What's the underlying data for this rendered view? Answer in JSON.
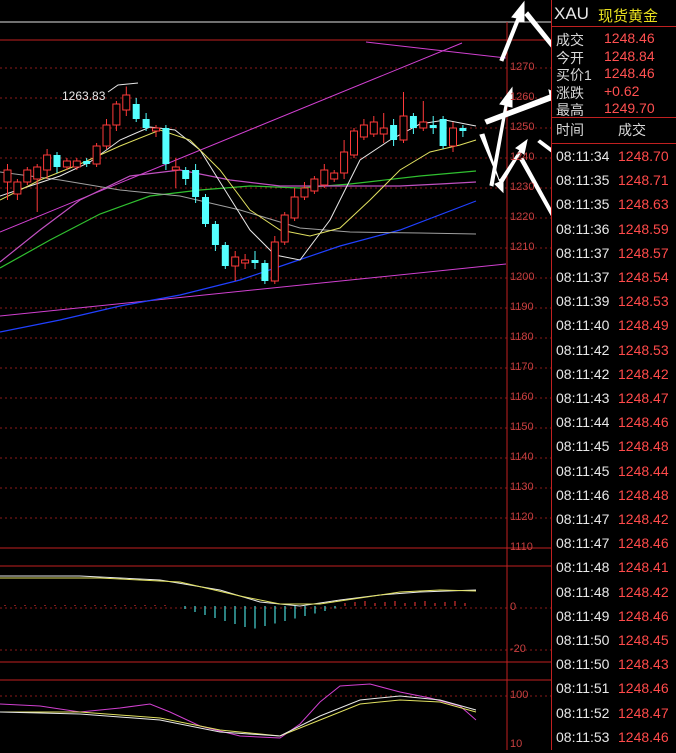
{
  "symbol": {
    "code": "XAU",
    "name": "现货黄金"
  },
  "quote": [
    {
      "label": "成交",
      "value": "1248.46"
    },
    {
      "label": "今开",
      "value": "1248.84"
    },
    {
      "label": "买价1",
      "value": "1248.46"
    },
    {
      "label": "涨跌",
      "value": "+0.62"
    },
    {
      "label": "最高",
      "value": "1249.70"
    }
  ],
  "trades_header": {
    "time": "时间",
    "price": "成交"
  },
  "trades": [
    {
      "time": "08:11:34",
      "price": "1248.70"
    },
    {
      "time": "08:11:35",
      "price": "1248.71"
    },
    {
      "time": "08:11:35",
      "price": "1248.63"
    },
    {
      "time": "08:11:36",
      "price": "1248.59"
    },
    {
      "time": "08:11:37",
      "price": "1248.57"
    },
    {
      "time": "08:11:37",
      "price": "1248.54"
    },
    {
      "time": "08:11:39",
      "price": "1248.53"
    },
    {
      "time": "08:11:40",
      "price": "1248.49"
    },
    {
      "time": "08:11:42",
      "price": "1248.53"
    },
    {
      "time": "08:11:42",
      "price": "1248.42"
    },
    {
      "time": "08:11:43",
      "price": "1248.47"
    },
    {
      "time": "08:11:44",
      "price": "1248.46"
    },
    {
      "time": "08:11:45",
      "price": "1248.48"
    },
    {
      "time": "08:11:45",
      "price": "1248.44"
    },
    {
      "time": "08:11:46",
      "price": "1248.48"
    },
    {
      "time": "08:11:47",
      "price": "1248.42"
    },
    {
      "time": "08:11:47",
      "price": "1248.46"
    },
    {
      "time": "08:11:48",
      "price": "1248.41"
    },
    {
      "time": "08:11:48",
      "price": "1248.42"
    },
    {
      "time": "08:11:49",
      "price": "1248.46"
    },
    {
      "time": "08:11:50",
      "price": "1248.45"
    },
    {
      "time": "08:11:50",
      "price": "1248.43"
    },
    {
      "time": "08:11:51",
      "price": "1248.46"
    },
    {
      "time": "08:11:52",
      "price": "1248.47"
    },
    {
      "time": "08:11:53",
      "price": "1248.46"
    }
  ],
  "price_axis": [
    "1270",
    "1260",
    "1250",
    "1240",
    "1230",
    "1220",
    "1210",
    "1200",
    "1190",
    "1180",
    "1170",
    "1160",
    "1150",
    "1140",
    "1130",
    "1120",
    "1110"
  ],
  "macd_axis": [
    "0",
    "-20"
  ],
  "kdj_axis": [
    "100",
    "10"
  ],
  "high_marker": "1263.83",
  "colors": {
    "up": "#ff3a3a",
    "down": "#54ffff",
    "grid": "#8a1a1a",
    "border": "#c02020",
    "axis_text": "#c84040"
  },
  "candles": [
    {
      "o": 1232,
      "c": 1236,
      "h": 1238,
      "l": 1226
    },
    {
      "o": 1228,
      "c": 1232,
      "h": 1233,
      "l": 1226
    },
    {
      "o": 1232,
      "c": 1236,
      "h": 1237,
      "l": 1231
    },
    {
      "o": 1233,
      "c": 1237,
      "h": 1238,
      "l": 1222
    },
    {
      "o": 1236,
      "c": 1241,
      "h": 1243,
      "l": 1233
    },
    {
      "o": 1241,
      "c": 1237,
      "h": 1242,
      "l": 1235
    },
    {
      "o": 1237,
      "c": 1239,
      "h": 1240,
      "l": 1236
    },
    {
      "o": 1237,
      "c": 1239,
      "h": 1240,
      "l": 1236
    },
    {
      "o": 1239,
      "c": 1238,
      "h": 1240,
      "l": 1237
    },
    {
      "o": 1238,
      "c": 1244,
      "h": 1245,
      "l": 1237
    },
    {
      "o": 1244,
      "c": 1251,
      "h": 1253,
      "l": 1243
    },
    {
      "o": 1251,
      "c": 1258,
      "h": 1259,
      "l": 1249
    },
    {
      "o": 1256,
      "c": 1261,
      "h": 1263.83,
      "l": 1254
    },
    {
      "o": 1258,
      "c": 1253,
      "h": 1260,
      "l": 1252
    },
    {
      "o": 1253,
      "c": 1250,
      "h": 1255,
      "l": 1249
    },
    {
      "o": 1249,
      "c": 1250,
      "h": 1251,
      "l": 1247
    },
    {
      "o": 1250,
      "c": 1238,
      "h": 1251,
      "l": 1236
    },
    {
      "o": 1236,
      "c": 1237,
      "h": 1240,
      "l": 1230
    },
    {
      "o": 1236,
      "c": 1233,
      "h": 1237,
      "l": 1231
    },
    {
      "o": 1236,
      "c": 1227,
      "h": 1238,
      "l": 1225
    },
    {
      "o": 1227,
      "c": 1218,
      "h": 1228,
      "l": 1217
    },
    {
      "o": 1218,
      "c": 1211,
      "h": 1219,
      "l": 1209
    },
    {
      "o": 1211,
      "c": 1204,
      "h": 1212,
      "l": 1203
    },
    {
      "o": 1204,
      "c": 1207,
      "h": 1209,
      "l": 1199
    },
    {
      "o": 1205,
      "c": 1206,
      "h": 1208,
      "l": 1203
    },
    {
      "o": 1206,
      "c": 1205,
      "h": 1209,
      "l": 1203
    },
    {
      "o": 1205,
      "c": 1199,
      "h": 1206,
      "l": 1198
    },
    {
      "o": 1199,
      "c": 1212,
      "h": 1214,
      "l": 1198
    },
    {
      "o": 1212,
      "c": 1221,
      "h": 1222,
      "l": 1211
    },
    {
      "o": 1220,
      "c": 1227,
      "h": 1230,
      "l": 1219
    },
    {
      "o": 1227,
      "c": 1230,
      "h": 1232,
      "l": 1226
    },
    {
      "o": 1229,
      "c": 1233,
      "h": 1234,
      "l": 1228
    },
    {
      "o": 1231,
      "c": 1236,
      "h": 1238,
      "l": 1230
    },
    {
      "o": 1233,
      "c": 1235,
      "h": 1236,
      "l": 1232
    },
    {
      "o": 1235,
      "c": 1242,
      "h": 1246,
      "l": 1233
    },
    {
      "o": 1241,
      "c": 1249,
      "h": 1250,
      "l": 1240
    },
    {
      "o": 1247,
      "c": 1251,
      "h": 1253,
      "l": 1246
    },
    {
      "o": 1248,
      "c": 1252,
      "h": 1254,
      "l": 1247
    },
    {
      "o": 1248,
      "c": 1250,
      "h": 1255,
      "l": 1245
    },
    {
      "o": 1251,
      "c": 1246,
      "h": 1253,
      "l": 1244
    },
    {
      "o": 1246,
      "c": 1254,
      "h": 1262,
      "l": 1245
    },
    {
      "o": 1254,
      "c": 1250,
      "h": 1255,
      "l": 1248
    },
    {
      "o": 1250,
      "c": 1252,
      "h": 1259,
      "l": 1249
    },
    {
      "o": 1251,
      "c": 1250,
      "h": 1254,
      "l": 1248
    },
    {
      "o": 1253,
      "c": 1244,
      "h": 1254,
      "l": 1243
    },
    {
      "o": 1244,
      "c": 1250,
      "h": 1252,
      "l": 1242
    },
    {
      "o": 1250,
      "c": 1249,
      "h": 1251,
      "l": 1247
    }
  ]
}
